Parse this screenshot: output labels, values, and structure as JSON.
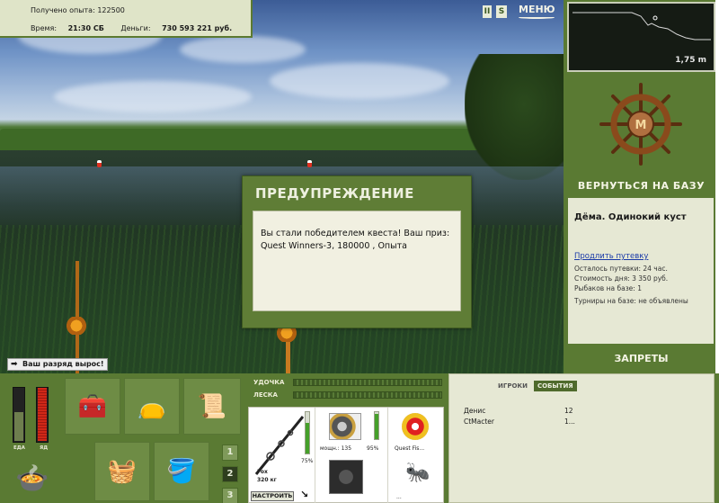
{
  "info": {
    "experience_label": "Получено опыта:",
    "experience_value": "122500",
    "time_label": "Время:",
    "time_value": "21:30 СБ",
    "money_label": "Деньги:",
    "money_value": "730 593 221 руб."
  },
  "topbar": {
    "btn1": "II",
    "btn2": "S",
    "menu_label": "МЕНЮ"
  },
  "depth": {
    "value": "1,75 m"
  },
  "base": {
    "return_label": "ВЕРНУТЬСЯ НА БАЗУ",
    "location_name": "Дёма. Одинокий куст",
    "extend_link": "Продлить путевку",
    "remaining": "Осталось путевки: 24 час.",
    "daily_cost": "Стоимость дня: 3 350 руб.",
    "anglers": "Рыбаков на базе: 1",
    "tournaments": "Турниры на базе: не объявлены",
    "bans_label": "ЗАПРЕТЫ"
  },
  "dialog": {
    "title": "ПРЕДУПРЕЖДЕНИЕ",
    "message": "Вы стали победителем квеста! Ваш приз: Quest Winners-3, 180000 , Опыта"
  },
  "toast": {
    "text": "Ваш разряд вырос!"
  },
  "status": {
    "food_label": "ЕДА",
    "poison_label": "ЯД",
    "food_level": 0.55,
    "poison_level": 1.0
  },
  "inventory": {
    "slots": [
      "tackle-box-icon",
      "bag-icon",
      "notebook-icon",
      "vegetables-basket-icon",
      "bucket-icon"
    ],
    "tabs": [
      "1",
      "2",
      "3"
    ],
    "active_tab": "2"
  },
  "gauges": {
    "rod_label": "УДОЧКА",
    "line_label": "ЛЕСКА"
  },
  "tackle": {
    "rod_name": "Fox",
    "rod_weight": "320 кг",
    "rod_percent": "75%",
    "reel_power": "мощн.: 135",
    "reel_percent": "95%",
    "line_name": "Quest Fis...",
    "tune_label": "НАСТРОИТЬ",
    "bait_dots": "..."
  },
  "events": {
    "tab_players": "ИГРОКИ",
    "tab_events": "СОБЫТИЯ",
    "rows": [
      {
        "name": "Денис",
        "value": "12"
      },
      {
        "name": "CtMacter",
        "value": "1..."
      }
    ]
  },
  "colors": {
    "panel_green": "#5a7a33",
    "info_bg": "#dfe4c8",
    "link": "#1a3aa8"
  }
}
